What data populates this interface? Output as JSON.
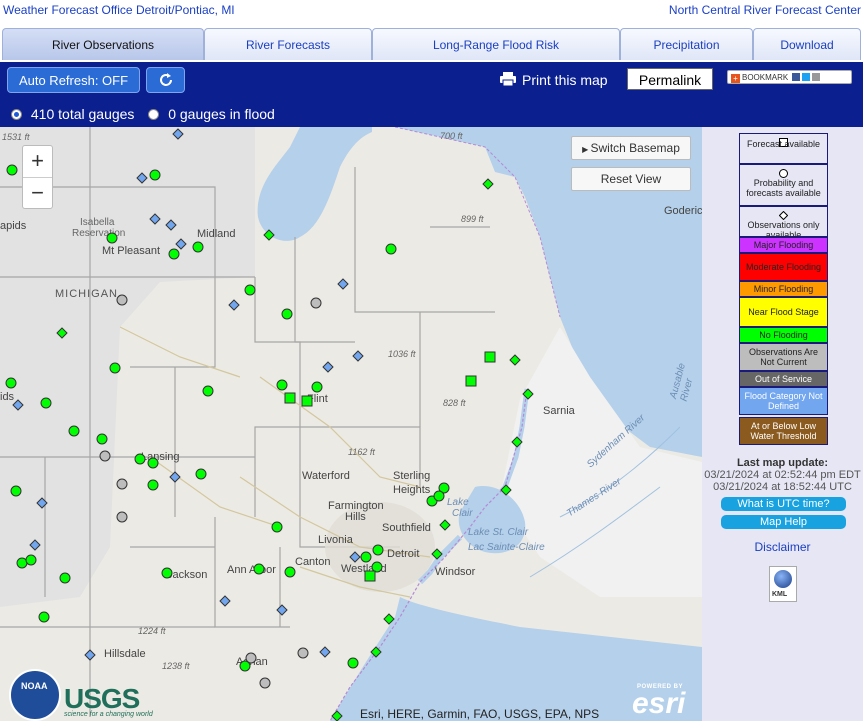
{
  "header": {
    "left_link": "Weather Forecast Office Detroit/Pontiac, MI",
    "right_link": "North Central River Forecast Center"
  },
  "tabs": [
    {
      "label": "River Observations",
      "active": true
    },
    {
      "label": "River Forecasts",
      "active": false
    },
    {
      "label": "Long-Range Flood Risk",
      "active": false
    },
    {
      "label": "Precipitation",
      "active": false
    },
    {
      "label": "Download",
      "active": false
    }
  ],
  "toolbar": {
    "auto_refresh_label": "Auto Refresh: OFF",
    "refresh_icon": "refresh-icon",
    "print_label": "Print this map",
    "permalink_label": "Permalink",
    "bookmark_label": "BOOKMARK"
  },
  "gauge_filter": {
    "total_label": "410 total gauges",
    "flood_label": "0 gauges in flood",
    "selected": "total"
  },
  "map": {
    "zoom_in": "+",
    "zoom_out": "−",
    "switch_basemap_label": "Switch Basemap",
    "reset_view_label": "Reset View",
    "attribution": "Esri, HERE, Garmin, FAO, USGS, EPA, NPS",
    "powered_by": "POWERED BY",
    "esri_logo": "esri",
    "noaa_logo": "NOAA",
    "usgs_logo": "USGS",
    "usgs_tagline": "science for a changing world",
    "labels": {
      "michigan": "MICHIGAN",
      "isabella": "Isabella",
      "reservation": "Reservation",
      "mt_pleasant": "Mt Pleasant",
      "midland": "Midland",
      "flint": "Flint",
      "lansing": "Lansing",
      "waterford": "Waterford",
      "sterling": "Sterling",
      "heights": "Heights",
      "farmington": "Farmington",
      "hills": "Hills",
      "southfield": "Southfield",
      "livonia": "Livonia",
      "detroit": "Detroit",
      "westland": "Westland",
      "canton": "Canton",
      "ann_arbor": "Ann Arbor",
      "jackson": "Jackson",
      "hillsdale": "Hillsdale",
      "adrian": "Adrian",
      "windsor": "Windsor",
      "sarnia": "Sarnia",
      "goderich": "Goderic",
      "lake_st_clair": "Lake St. Clair",
      "lac_sainte_claire": "Lac Sainte-Claire",
      "lake_label": "Lake",
      "clair_label": "Clair",
      "thames": "Thames River",
      "sydenham": "Sydenham River",
      "ausable": "Ausable River",
      "rapids": "apids",
      "ids": "ids",
      "elev_1531": "1531 ft",
      "elev_700": "700 ft",
      "elev_899": "899 ft",
      "elev_1036": "1036 ft",
      "elev_828": "828 ft",
      "elev_1162": "1162 ft",
      "elev_1224": "1224 ft",
      "elev_1238": "1238 ft"
    }
  },
  "legend": {
    "items": [
      {
        "label": "Forecast available",
        "bg": "#ffffff",
        "symbol": "square"
      },
      {
        "label": "Probability and forecasts available",
        "bg": "#ffffff",
        "symbol": "circle"
      },
      {
        "label": "Observations only available",
        "bg": "#ffffff",
        "symbol": "diamond"
      },
      {
        "label": "Major Flooding",
        "bg": "#cc33ff"
      },
      {
        "label": "Moderate Flooding",
        "bg": "#ff0000"
      },
      {
        "label": "Minor Flooding",
        "bg": "#ff9900"
      },
      {
        "label": "Near Flood Stage",
        "bg": "#ffff00"
      },
      {
        "label": "No Flooding",
        "bg": "#00ff00"
      },
      {
        "label": "Observations Are Not Current",
        "bg": "#bdbdbd"
      },
      {
        "label": "Out of Service",
        "bg": "#666666",
        "text_color": "#ffffff"
      },
      {
        "label": "Flood Category Not Defined",
        "bg": "#72a6ef",
        "text_color": "#ffffff"
      },
      {
        "label": "At or Below Low Water Threshold",
        "bg": "#8b5a1f",
        "text_color": "#ffffff"
      }
    ],
    "last_update_title": "Last map update:",
    "last_update_edt": "03/21/2024 at 02:52:44 pm EDT",
    "last_update_utc": "03/21/2024 at 18:52:44 UTC",
    "utc_help": "What is UTC time?",
    "map_help": "Map Help",
    "disclaimer": "Disclaimer",
    "kml_label": "KML"
  },
  "colors": {
    "no_flooding": "#00ff00",
    "not_current": "#bdbdbd",
    "not_defined": "#72a6ef",
    "water": "#b5d0ea",
    "toolbar": "#0b1f8f"
  }
}
